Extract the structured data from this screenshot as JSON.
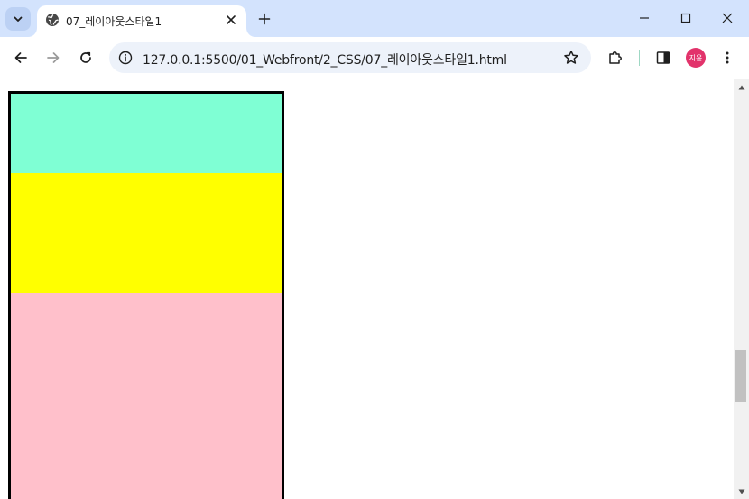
{
  "tab": {
    "title": "07_레이아웃스타일1",
    "favicon": "globe-icon"
  },
  "toolbar": {
    "url": "127.0.0.1:5500/01_Webfront/2_CSS/07_레이아웃스타일1.html"
  },
  "profile": {
    "avatar_text": "지윤",
    "avatar_color": "#e2336b"
  },
  "page": {
    "boxes": [
      {
        "color": "#7fffd4"
      },
      {
        "color": "#ffff00"
      },
      {
        "color": "#ffc0cb"
      }
    ],
    "border_color": "#000000"
  },
  "theme": {
    "tabstrip_bg": "#d3e3fd",
    "omnibox_bg": "#edf2fa"
  }
}
